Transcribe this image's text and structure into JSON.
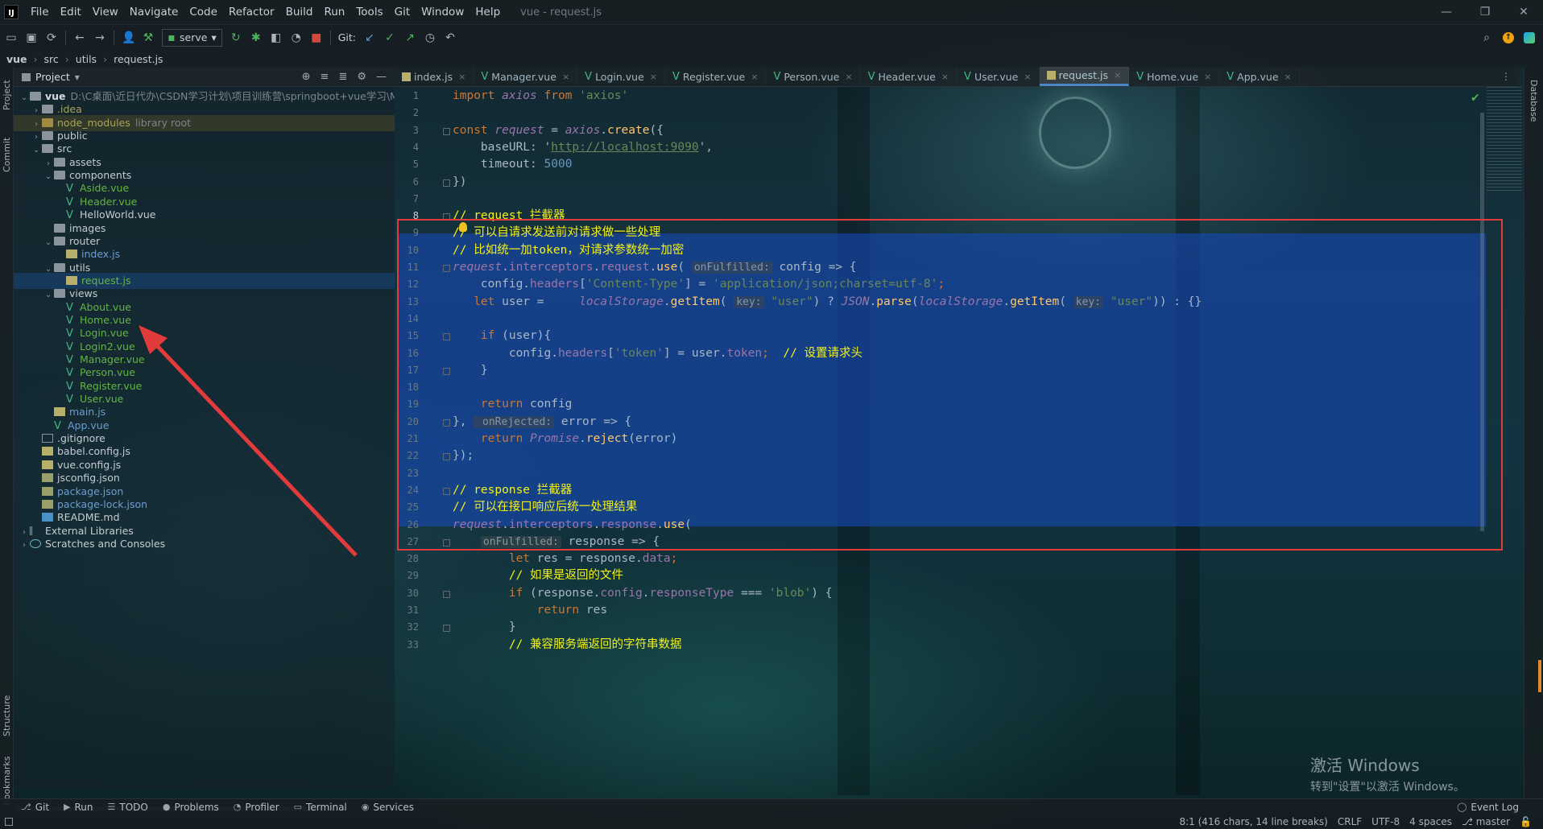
{
  "menu": [
    "File",
    "Edit",
    "View",
    "Navigate",
    "Code",
    "Refactor",
    "Build",
    "Run",
    "Tools",
    "Git",
    "Window",
    "Help"
  ],
  "window_title": "vue - request.js",
  "toolbar": {
    "run_config": "serve",
    "git_label": "Git:"
  },
  "breadcrumbs": [
    "vue",
    "src",
    "utils",
    "request.js"
  ],
  "left_strip": [
    "Project",
    "Commit",
    "Structure",
    "Bookmarks"
  ],
  "right_strip": [
    "Database"
  ],
  "project_panel": {
    "title": "Project"
  },
  "tree": [
    {
      "label": "vue",
      "hint": "D:\\C桌面\\近日代办\\CSDN学习计划\\项目训练营\\springboot+vue学习\\My",
      "depth": 0,
      "kind": "folder-open",
      "bold": true
    },
    {
      "label": ".idea",
      "depth": 1,
      "kind": "folder",
      "color": "olive"
    },
    {
      "label": "node_modules",
      "hint": "library root",
      "depth": 1,
      "kind": "folder-ex",
      "color": "olive"
    },
    {
      "label": "public",
      "depth": 1,
      "kind": "folder"
    },
    {
      "label": "src",
      "depth": 1,
      "kind": "folder-open"
    },
    {
      "label": "assets",
      "depth": 2,
      "kind": "folder"
    },
    {
      "label": "components",
      "depth": 2,
      "kind": "folder-open"
    },
    {
      "label": "Aside.vue",
      "depth": 3,
      "kind": "vue",
      "color": "green"
    },
    {
      "label": "Header.vue",
      "depth": 3,
      "kind": "vue",
      "color": "green"
    },
    {
      "label": "HelloWorld.vue",
      "depth": 3,
      "kind": "vue"
    },
    {
      "label": "images",
      "depth": 2,
      "kind": "folder-leaf"
    },
    {
      "label": "router",
      "depth": 2,
      "kind": "folder-open"
    },
    {
      "label": "index.js",
      "depth": 3,
      "kind": "js",
      "color": "blue"
    },
    {
      "label": "utils",
      "depth": 2,
      "kind": "folder-open"
    },
    {
      "label": "request.js",
      "depth": 3,
      "kind": "js",
      "color": "green",
      "selected": true
    },
    {
      "label": "views",
      "depth": 2,
      "kind": "folder-open"
    },
    {
      "label": "About.vue",
      "depth": 3,
      "kind": "vue",
      "color": "green"
    },
    {
      "label": "Home.vue",
      "depth": 3,
      "kind": "vue",
      "color": "green"
    },
    {
      "label": "Login.vue",
      "depth": 3,
      "kind": "vue",
      "color": "green"
    },
    {
      "label": "Login2.vue",
      "depth": 3,
      "kind": "vue",
      "color": "green"
    },
    {
      "label": "Manager.vue",
      "depth": 3,
      "kind": "vue",
      "color": "green"
    },
    {
      "label": "Person.vue",
      "depth": 3,
      "kind": "vue",
      "color": "green"
    },
    {
      "label": "Register.vue",
      "depth": 3,
      "kind": "vue",
      "color": "green"
    },
    {
      "label": "User.vue",
      "depth": 3,
      "kind": "vue",
      "color": "green"
    },
    {
      "label": "main.js",
      "depth": 2,
      "kind": "js",
      "color": "blue"
    },
    {
      "label": "App.vue",
      "depth": 2,
      "kind": "vue",
      "color": "blue"
    },
    {
      "label": ".gitignore",
      "depth": 1,
      "kind": "file"
    },
    {
      "label": "babel.config.js",
      "depth": 1,
      "kind": "js"
    },
    {
      "label": "vue.config.js",
      "depth": 1,
      "kind": "js"
    },
    {
      "label": "jsconfig.json",
      "depth": 1,
      "kind": "json"
    },
    {
      "label": "package.json",
      "depth": 1,
      "kind": "json",
      "color": "blue"
    },
    {
      "label": "package-lock.json",
      "depth": 1,
      "kind": "json",
      "color": "blue"
    },
    {
      "label": "README.md",
      "depth": 1,
      "kind": "md"
    },
    {
      "label": "External Libraries",
      "depth": 0,
      "kind": "lib"
    },
    {
      "label": "Scratches and Consoles",
      "depth": 0,
      "kind": "scratch"
    }
  ],
  "tabs": [
    {
      "label": "index.js",
      "type": "js"
    },
    {
      "label": "Manager.vue",
      "type": "vue"
    },
    {
      "label": "Login.vue",
      "type": "vue"
    },
    {
      "label": "Register.vue",
      "type": "vue"
    },
    {
      "label": "Person.vue",
      "type": "vue"
    },
    {
      "label": "Header.vue",
      "type": "vue"
    },
    {
      "label": "User.vue",
      "type": "vue"
    },
    {
      "label": "request.js",
      "type": "js",
      "active": true
    },
    {
      "label": "Home.vue",
      "type": "vue"
    },
    {
      "label": "App.vue",
      "type": "vue"
    }
  ],
  "code_lines": [
    [
      [
        "import ",
        "kw"
      ],
      [
        "axios",
        "pr it"
      ],
      [
        " from ",
        "kw"
      ],
      [
        "'axios'",
        "str"
      ]
    ],
    [],
    [
      [
        "const ",
        "kw"
      ],
      [
        "request",
        "pr it"
      ],
      [
        " = ",
        ""
      ],
      [
        "axios",
        "pr it"
      ],
      [
        ".",
        ""
      ],
      [
        "create",
        "fn"
      ],
      [
        "({",
        ""
      ]
    ],
    [
      [
        "    baseURL: ",
        ""
      ],
      [
        "'",
        ""
      ],
      [
        "http://localhost:9090",
        "url"
      ],
      [
        "',",
        ""
      ]
    ],
    [
      [
        "    timeout: ",
        ""
      ],
      [
        "5000",
        "num"
      ]
    ],
    [
      [
        "})",
        ""
      ]
    ],
    [],
    [
      [
        "// request 拦截器",
        "cm"
      ]
    ],
    [
      [
        "// 可以自请求发送前对请求做一些处理",
        "cm"
      ]
    ],
    [
      [
        "// 比如统一加token，对请求参数统一加密",
        "cm"
      ]
    ],
    [
      [
        "request",
        "pr it"
      ],
      [
        ".",
        ""
      ],
      [
        "interceptors",
        "pr"
      ],
      [
        ".",
        ""
      ],
      [
        "request",
        "pr"
      ],
      [
        ".",
        ""
      ],
      [
        "use",
        "fn"
      ],
      [
        "( ",
        ""
      ],
      [
        "onFulfilled:",
        "hintlbl"
      ],
      [
        " config => {",
        ""
      ]
    ],
    [
      [
        "    config.",
        ""
      ],
      [
        "headers",
        "pr"
      ],
      [
        "[",
        ""
      ],
      [
        "'Content-Type'",
        "str"
      ],
      [
        "] = ",
        ""
      ],
      [
        "'application/json;charset=utf-8'",
        "str"
      ],
      [
        ";",
        "kw"
      ]
    ],
    [
      [
        "   let ",
        "kw"
      ],
      [
        "user = ",
        ""
      ],
      [
        "    localStorage",
        "pr it"
      ],
      [
        ".",
        ""
      ],
      [
        "getItem",
        "fn"
      ],
      [
        "( ",
        ""
      ],
      [
        "key:",
        "hintlbl"
      ],
      [
        " \"user\"",
        "str"
      ],
      [
        ") ? ",
        ""
      ],
      [
        "JSON",
        "pr it"
      ],
      [
        ".",
        ""
      ],
      [
        "parse",
        "fn"
      ],
      [
        "(",
        ""
      ],
      [
        "localStorage",
        "pr it"
      ],
      [
        ".",
        ""
      ],
      [
        "getItem",
        "fn"
      ],
      [
        "( ",
        ""
      ],
      [
        "key:",
        "hintlbl"
      ],
      [
        " \"user\"",
        "str"
      ],
      [
        ")) : {}",
        ""
      ]
    ],
    [],
    [
      [
        "    if ",
        "kw"
      ],
      [
        "(user){",
        ""
      ]
    ],
    [
      [
        "        config.",
        ""
      ],
      [
        "headers",
        "pr"
      ],
      [
        "[",
        ""
      ],
      [
        "'token'",
        "str"
      ],
      [
        "] = user.",
        ""
      ],
      [
        "token",
        "pr"
      ],
      [
        ";",
        "kw"
      ],
      [
        "  // 设置请求头",
        "cm"
      ]
    ],
    [
      [
        "    }",
        ""
      ]
    ],
    [],
    [
      [
        "    return ",
        "kw"
      ],
      [
        "config",
        ""
      ]
    ],
    [
      [
        "}, ",
        ""
      ],
      [
        " onRejected:",
        "hintlbl"
      ],
      [
        " error => {",
        ""
      ]
    ],
    [
      [
        "    return ",
        "kw"
      ],
      [
        "Promise",
        "pr it"
      ],
      [
        ".",
        ""
      ],
      [
        "reject",
        "fn"
      ],
      [
        "(error)",
        ""
      ]
    ],
    [
      [
        "});",
        ""
      ]
    ],
    [],
    [
      [
        "// response 拦截器",
        "cm"
      ]
    ],
    [
      [
        "// 可以在接口响应后统一处理结果",
        "cm"
      ]
    ],
    [
      [
        "request",
        "pr it"
      ],
      [
        ".",
        ""
      ],
      [
        "interceptors",
        "pr"
      ],
      [
        ".",
        ""
      ],
      [
        "response",
        "pr"
      ],
      [
        ".",
        ""
      ],
      [
        "use",
        "fn"
      ],
      [
        "(",
        ""
      ]
    ],
    [
      [
        "    ",
        ""
      ],
      [
        "onFulfilled:",
        "hintlbl"
      ],
      [
        " response => {",
        ""
      ]
    ],
    [
      [
        "        let ",
        "kw"
      ],
      [
        "res = response.",
        ""
      ],
      [
        "data",
        "pr"
      ],
      [
        ";",
        "kw"
      ]
    ],
    [
      [
        "        // 如果是返回的文件",
        "cm"
      ]
    ],
    [
      [
        "        if ",
        "kw"
      ],
      [
        "(response.",
        ""
      ],
      [
        "config",
        "pr"
      ],
      [
        ".",
        ""
      ],
      [
        "responseType",
        "pr"
      ],
      [
        " === ",
        ""
      ],
      [
        "'blob'",
        "str"
      ],
      [
        ") {",
        ""
      ]
    ],
    [
      [
        "            return ",
        "kw"
      ],
      [
        "res",
        ""
      ]
    ],
    [
      [
        "        }",
        ""
      ]
    ],
    [
      [
        "        // 兼容服务端返回的字符串数据",
        "cm"
      ]
    ]
  ],
  "current_line": 8,
  "bottom_tools": [
    "Git",
    "Run",
    "TODO",
    "Problems",
    "Profiler",
    "Terminal",
    "Services"
  ],
  "event_log": "Event Log",
  "status": {
    "position": "8:1 (416 chars, 14 line breaks)",
    "line_sep": "CRLF",
    "encoding": "UTF-8",
    "indent": "4 spaces",
    "branch": "master"
  },
  "activate": {
    "line1": "激活 Windows",
    "line2": "转到\"设置\"以激活 Windows。"
  },
  "colors": {
    "selection": "#1748b4",
    "annotation_red": "#e23b3b",
    "keyword": "#cc7832",
    "comment_highlight": "#f2f21a"
  }
}
